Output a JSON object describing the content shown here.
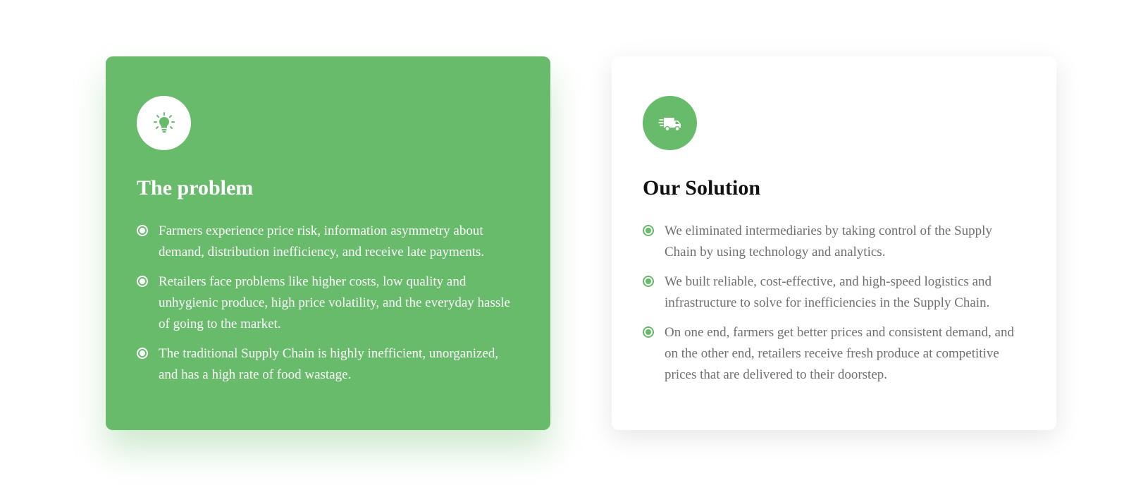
{
  "colors": {
    "accent_green": "#68bb6a",
    "white": "#ffffff",
    "solution_text": "#6f6f6f",
    "heading_dark": "#111111"
  },
  "problem": {
    "icon": "lightbulb-icon",
    "title": "The problem",
    "points": [
      "Farmers experience price risk, information asymmetry about demand, distribution inefficiency, and receive late payments.",
      "Retailers face problems like higher costs, low quality and unhygienic produce, high price volatility, and the everyday hassle of going to the market.",
      "The traditional Supply Chain is highly inefficient, unorganized, and has a high rate of food wastage."
    ]
  },
  "solution": {
    "icon": "delivery-truck-icon",
    "title": "Our Solution",
    "points": [
      "We eliminated intermediaries by taking control of the Supply Chain by using technology and analytics.",
      "We built reliable, cost-effective, and high-speed logistics and infrastructure to solve for inefficiencies in the Supply Chain.",
      "On one end, farmers get better prices and consistent demand, and on the other end, retailers receive fresh produce at competitive prices that are delivered to their doorstep."
    ]
  }
}
